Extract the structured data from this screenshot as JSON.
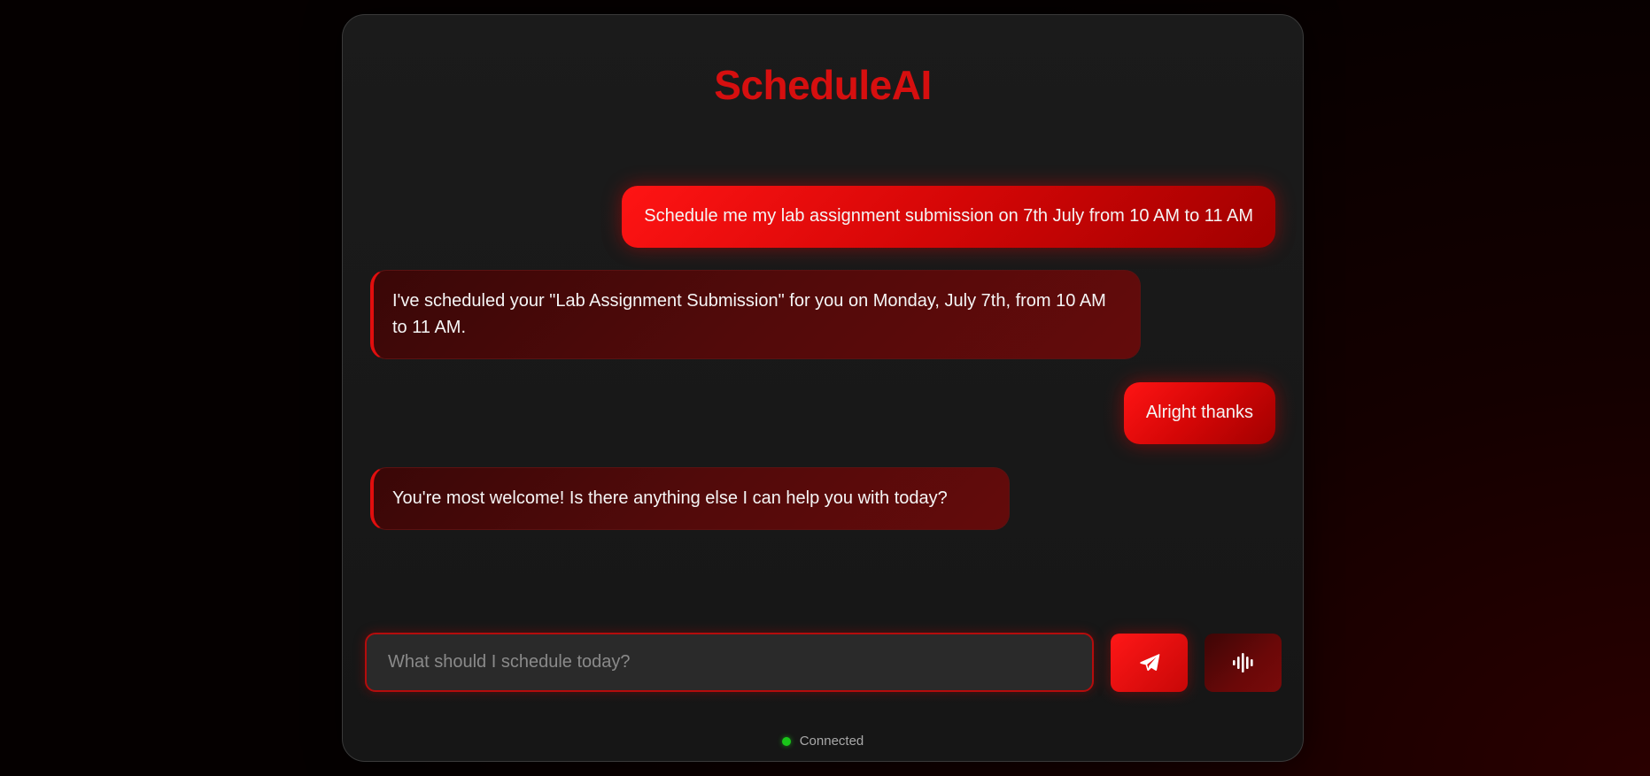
{
  "app": {
    "title": "ScheduleAI"
  },
  "messages": [
    {
      "role": "user",
      "text": "Schedule me my lab assignment submission on 7th July from 10 AM to 11 AM"
    },
    {
      "role": "assistant",
      "text": "I've scheduled your \"Lab Assignment Submission\" for you on Monday, July 7th, from 10 AM to 11 AM."
    },
    {
      "role": "user",
      "text": "Alright thanks"
    },
    {
      "role": "assistant",
      "text": "You're most welcome! Is there anything else I can help you with today?"
    }
  ],
  "composer": {
    "placeholder": "What should I schedule today?",
    "value": "",
    "send_icon": "paper-plane-icon",
    "voice_icon": "waveform-icon"
  },
  "status": {
    "text": "Connected",
    "color": "#19c619"
  },
  "colors": {
    "accent": "#d60f0f",
    "panel": "#1b1b1b"
  }
}
